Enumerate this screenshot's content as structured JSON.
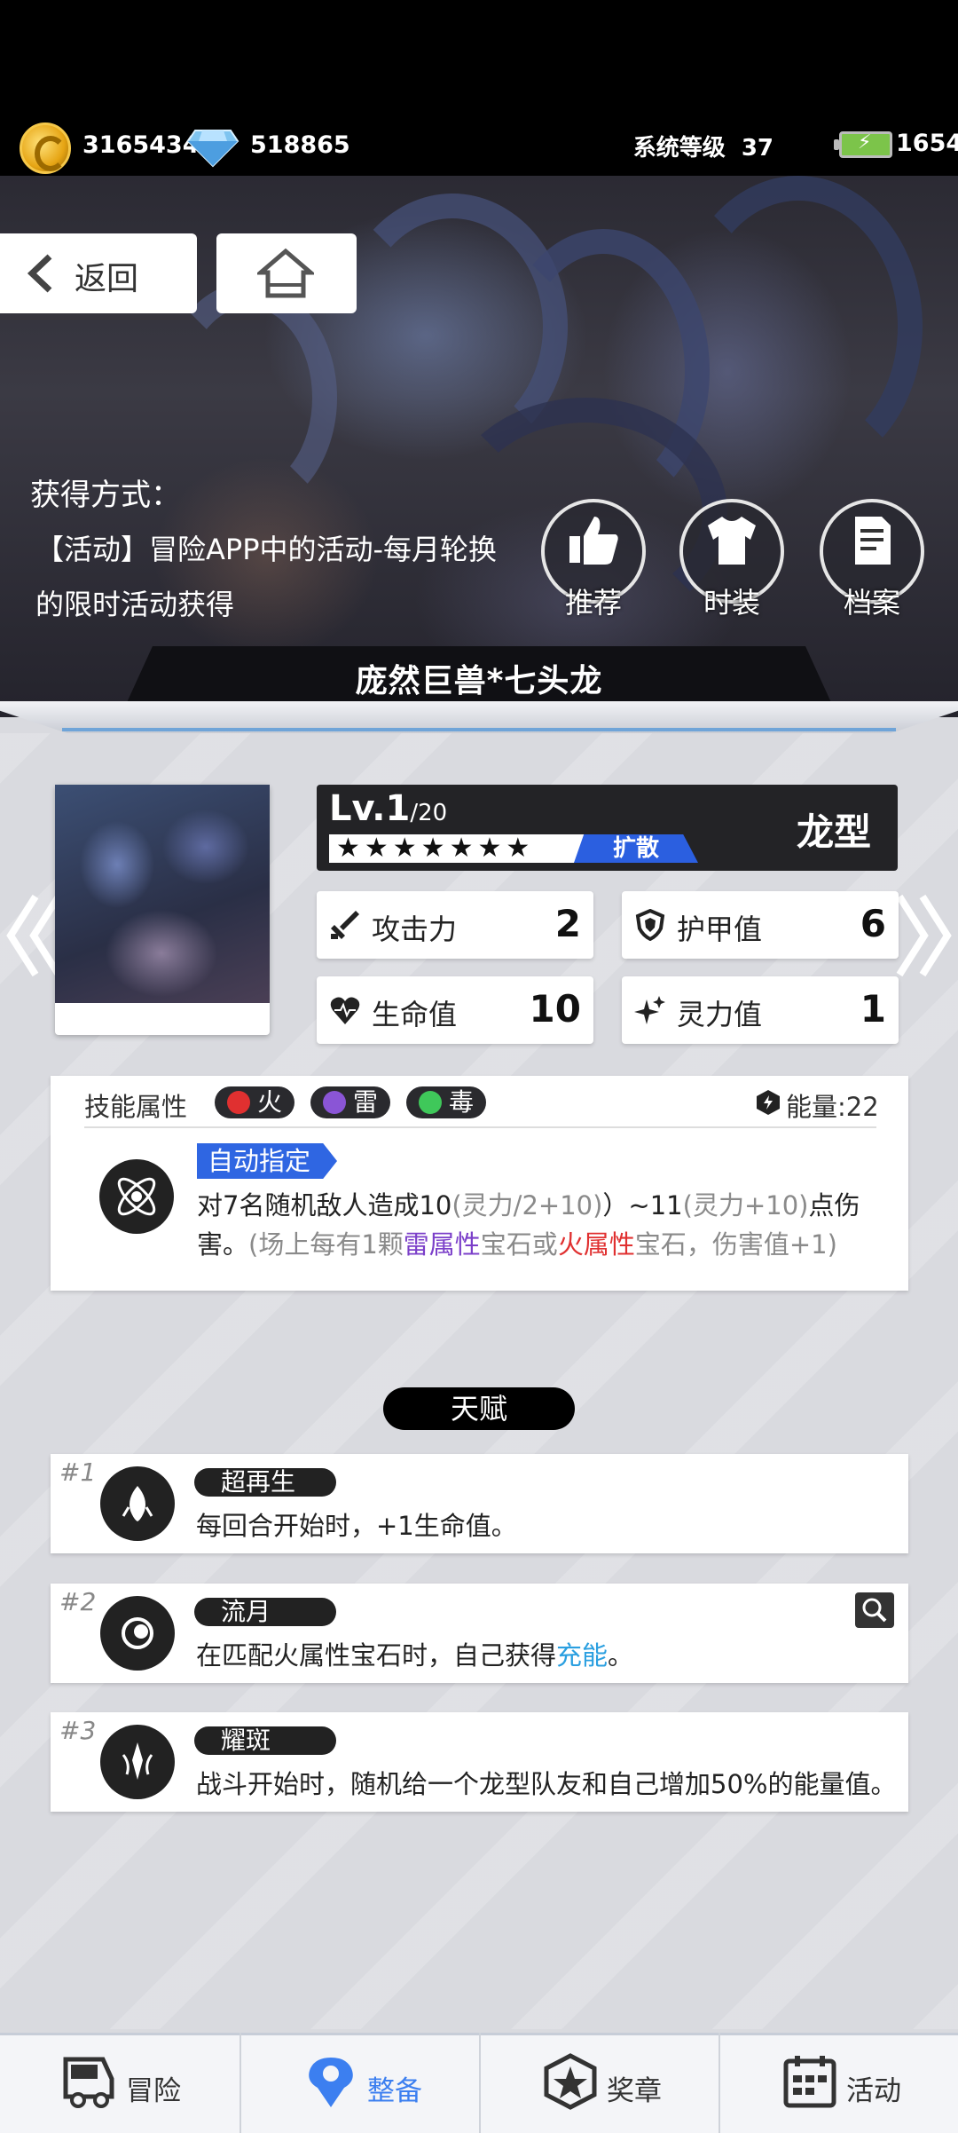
{
  "status": {
    "coins": "3165434",
    "diamonds": "518865",
    "system_level_label": "系统等级",
    "system_level": "37",
    "energy": "1654"
  },
  "nav": {
    "back_label": "返回"
  },
  "acquisition": {
    "title": "获得方式：",
    "desc": "【活动】冒险APP中的活动-每月轮换的限时活动获得"
  },
  "actions": [
    {
      "label": "推荐",
      "icon": "thumbs-up-icon"
    },
    {
      "label": "时装",
      "icon": "shirt-icon"
    },
    {
      "label": "档案",
      "icon": "file-icon"
    }
  ],
  "hero": {
    "name": "庞然巨兽*七头龙",
    "level": "Lv.1",
    "level_max": "/20",
    "stars": "★★★★★★★",
    "tag": "扩散",
    "race": "龙型"
  },
  "stats": {
    "attack": {
      "label": "攻击力",
      "value": "2"
    },
    "armor": {
      "label": "护甲值",
      "value": "6"
    },
    "hp": {
      "label": "生命值",
      "value": "10"
    },
    "spirit": {
      "label": "灵力值",
      "value": "1"
    }
  },
  "skill": {
    "label": "技能属性",
    "elements": [
      {
        "name": "火",
        "color": "#e03030"
      },
      {
        "name": "雷",
        "color": "#8a55d6"
      },
      {
        "name": "毒",
        "color": "#3fc85a"
      }
    ],
    "energy": "能量:22",
    "type": "自动指定",
    "desc_1": "对7名随机敌人造成10",
    "desc_2": "(灵力/2+10)",
    "desc_3": "）~11",
    "desc_4": "(灵力+10)",
    "desc_5": "点伤害。",
    "desc_6": "(场上每有1颗",
    "desc_7": "雷属性",
    "desc_8": "宝石或",
    "desc_9": "火属性",
    "desc_10": "宝石，伤害值+1)"
  },
  "talents": {
    "title": "天赋",
    "items": [
      {
        "num": "#1",
        "name": "超再生",
        "desc": "每回合开始时，+1生命值。"
      },
      {
        "num": "#2",
        "name": "流月",
        "desc_a": "在匹配火属性宝石时，自己获得",
        "desc_b": "充能",
        "desc_c": "。"
      },
      {
        "num": "#3",
        "name": "耀斑",
        "desc": "战斗开始时，随机给一个龙型队友和自己增加50%的能量值。"
      }
    ]
  },
  "bottom_nav": [
    {
      "label": "冒险",
      "icon": "truck-icon"
    },
    {
      "label": "整备",
      "icon": "equip-icon",
      "active": true
    },
    {
      "label": "奖章",
      "icon": "medal-icon"
    },
    {
      "label": "活动",
      "icon": "calendar-icon"
    }
  ],
  "colors": {
    "accent_blue": "#2f66e2",
    "fire": "#e03030",
    "thunder": "#7b3fc9",
    "charge": "#2a9fe0"
  }
}
